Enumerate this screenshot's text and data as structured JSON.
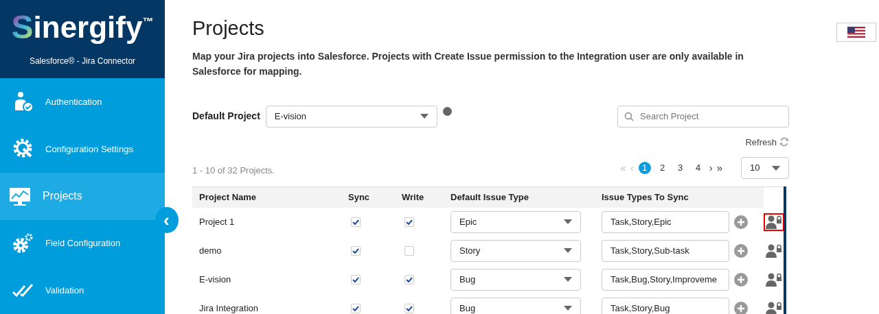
{
  "sidebar": {
    "brand_initial": "S",
    "brand": "inergify",
    "trademark": "™",
    "subtitle": "Salesforce® - Jira Connector",
    "items": [
      {
        "label": "Authentication",
        "selected": false
      },
      {
        "label": "Configuration Settings",
        "selected": false
      },
      {
        "label": "Projects",
        "selected": true
      },
      {
        "label": "Field Configuration",
        "selected": false
      },
      {
        "label": "Validation",
        "selected": false
      }
    ],
    "collapse_button": "‹"
  },
  "page": {
    "title": "Projects",
    "description": "Map your Jira projects into Salesforce. Projects with Create Issue permission to the Integration user are only available in Salesforce for mapping."
  },
  "default_project": {
    "label": "Default Project",
    "value": "E-vision"
  },
  "search": {
    "placeholder": "Search Project"
  },
  "refresh": {
    "label": "Refresh"
  },
  "summary": "1 - 10 of 32 Projects.",
  "pagination": {
    "first": {
      "label": "«",
      "disabled": true
    },
    "prev": {
      "label": "‹",
      "disabled": true
    },
    "pages": [
      {
        "label": "1",
        "selected": true
      },
      {
        "label": "2",
        "selected": false
      },
      {
        "label": "3",
        "selected": false
      },
      {
        "label": "4",
        "selected": false
      }
    ],
    "next": {
      "label": "›",
      "disabled": false
    },
    "last": {
      "label": "»",
      "disabled": false
    },
    "page_size": "10"
  },
  "table": {
    "columns": [
      "Project Name",
      "Sync",
      "Write",
      "Default Issue Type",
      "Issue Types To Sync"
    ],
    "rows": [
      {
        "name": "Project 1",
        "sync": true,
        "write": true,
        "default_issue_type": "Epic",
        "issue_types": "Task,Story,Epic",
        "highlighted": true
      },
      {
        "name": "demo",
        "sync": true,
        "write": false,
        "default_issue_type": "Story",
        "issue_types": "Task,Story,Sub-task",
        "highlighted": false
      },
      {
        "name": "E-vision",
        "sync": true,
        "write": true,
        "default_issue_type": "Bug",
        "issue_types": "Task,Bug,Story,Improveme",
        "highlighted": false
      },
      {
        "name": "Jira Integration",
        "sync": true,
        "write": true,
        "default_issue_type": "Bug",
        "issue_types": "Task,Story,Bug",
        "highlighted": false
      }
    ]
  }
}
